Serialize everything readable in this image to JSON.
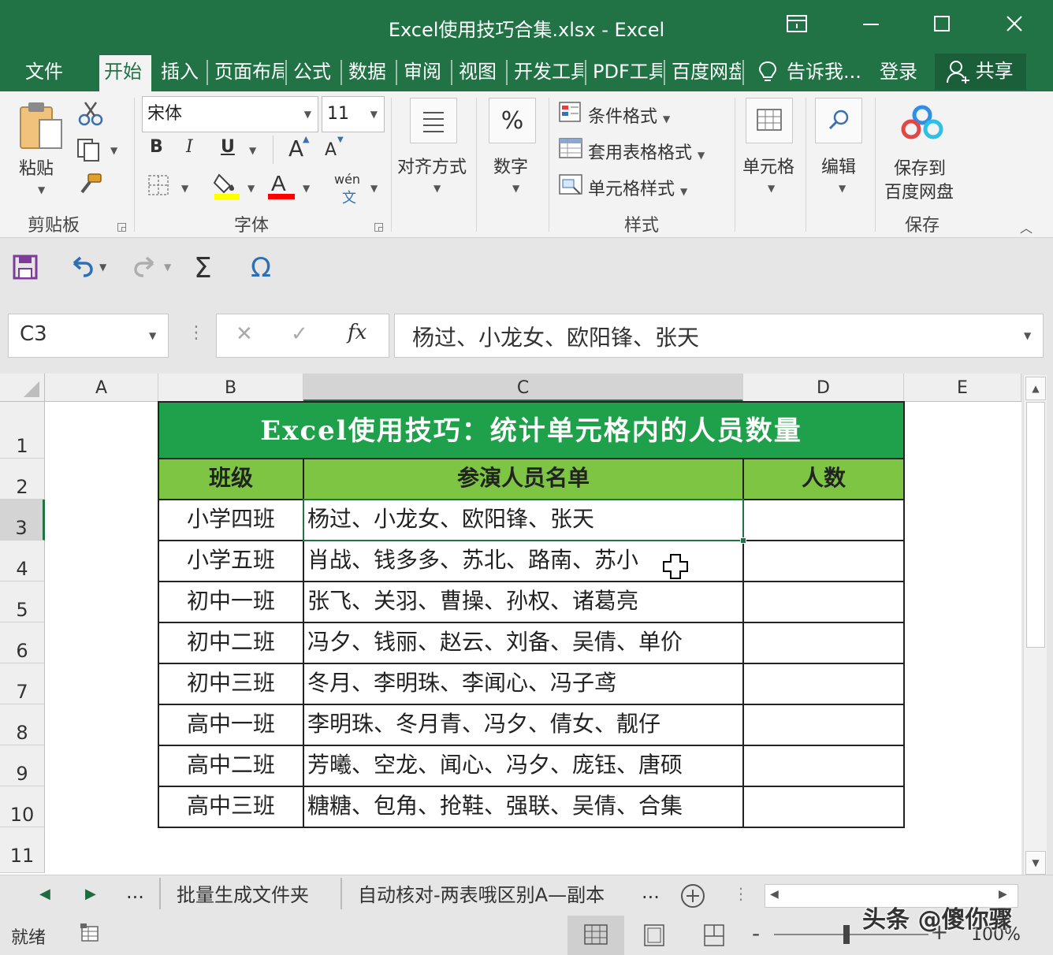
{
  "window": {
    "title": "Excel使用技巧合集.xlsx  -  Excel",
    "controls": [
      "ribbon-display",
      "minimize",
      "maximize",
      "close"
    ]
  },
  "ribbon_tabs": [
    {
      "label": "文件",
      "active": false
    },
    {
      "label": "开始",
      "active": true
    },
    {
      "label": "插入",
      "active": false
    },
    {
      "label": "页面布局",
      "active": false
    },
    {
      "label": "公式",
      "active": false
    },
    {
      "label": "数据",
      "active": false
    },
    {
      "label": "审阅",
      "active": false
    },
    {
      "label": "视图",
      "active": false
    },
    {
      "label": "开发工具",
      "active": false
    },
    {
      "label": "PDF工具",
      "active": false
    },
    {
      "label": "百度网盘",
      "active": false
    }
  ],
  "tell_me": "告诉我...",
  "login": "登录",
  "share": "共享",
  "ribbon": {
    "clipboard": {
      "paste": "粘贴",
      "group": "剪贴板"
    },
    "font": {
      "name": "宋体",
      "size": "11",
      "group": "字体",
      "bold": "B",
      "italic": "I",
      "underline": "U",
      "grow": "A",
      "shrink": "A",
      "phonetic": "wén"
    },
    "alignment": {
      "label": "对齐方式"
    },
    "number": {
      "label": "数字",
      "icon": "%"
    },
    "styles": {
      "conditional": "条件格式",
      "table": "套用表格格式",
      "cell": "单元格样式",
      "group": "样式"
    },
    "cells": {
      "label": "单元格"
    },
    "editing": {
      "label": "编辑"
    },
    "save": {
      "label_line1": "保存到",
      "label_line2": "百度网盘",
      "group": "保存"
    }
  },
  "formula_bar": {
    "name_box": "C3",
    "formula": "杨过、小龙女、欧阳锋、张天"
  },
  "columns": [
    "A",
    "B",
    "C",
    "D",
    "E"
  ],
  "rows": [
    "1",
    "2",
    "3",
    "4",
    "5",
    "6",
    "7",
    "8",
    "9",
    "10",
    "11"
  ],
  "sheet": {
    "title": "Excel使用技巧：统计单元格内的人员数量",
    "headers": [
      "班级",
      "参演人员名单",
      "人数"
    ],
    "data": [
      {
        "class": "小学四班",
        "names": "杨过、小龙女、欧阳锋、张天",
        "count": ""
      },
      {
        "class": "小学五班",
        "names": "肖战、钱多多、苏北、路南、苏小",
        "count": ""
      },
      {
        "class": "初中一班",
        "names": "张飞、关羽、曹操、孙权、诸葛亮",
        "count": ""
      },
      {
        "class": "初中二班",
        "names": "冯夕、钱丽、赵云、刘备、吴倩、单价",
        "count": ""
      },
      {
        "class": "初中三班",
        "names": "冬月、李明珠、李闻心、冯子鸢",
        "count": ""
      },
      {
        "class": "高中一班",
        "names": "李明珠、冬月青、冯夕、倩女、靓仔",
        "count": ""
      },
      {
        "class": "高中二班",
        "names": "芳曦、空龙、闻心、冯夕、庞钰、唐硕",
        "count": ""
      },
      {
        "class": "高中三班",
        "names": "糖糖、包角、抢鞋、强联、吴倩、合集",
        "count": ""
      }
    ]
  },
  "sheet_tabs": [
    "批量生成文件夹",
    "自动核对-两表哦区别A—副本"
  ],
  "sheet_more": "...",
  "status": {
    "ready": "就绪",
    "zoom": "100%"
  },
  "watermark": "头条 @傻你骤",
  "colors": {
    "excel_green": "#217346",
    "title_fill": "#1fa04a",
    "header_fill": "#7dc542"
  }
}
